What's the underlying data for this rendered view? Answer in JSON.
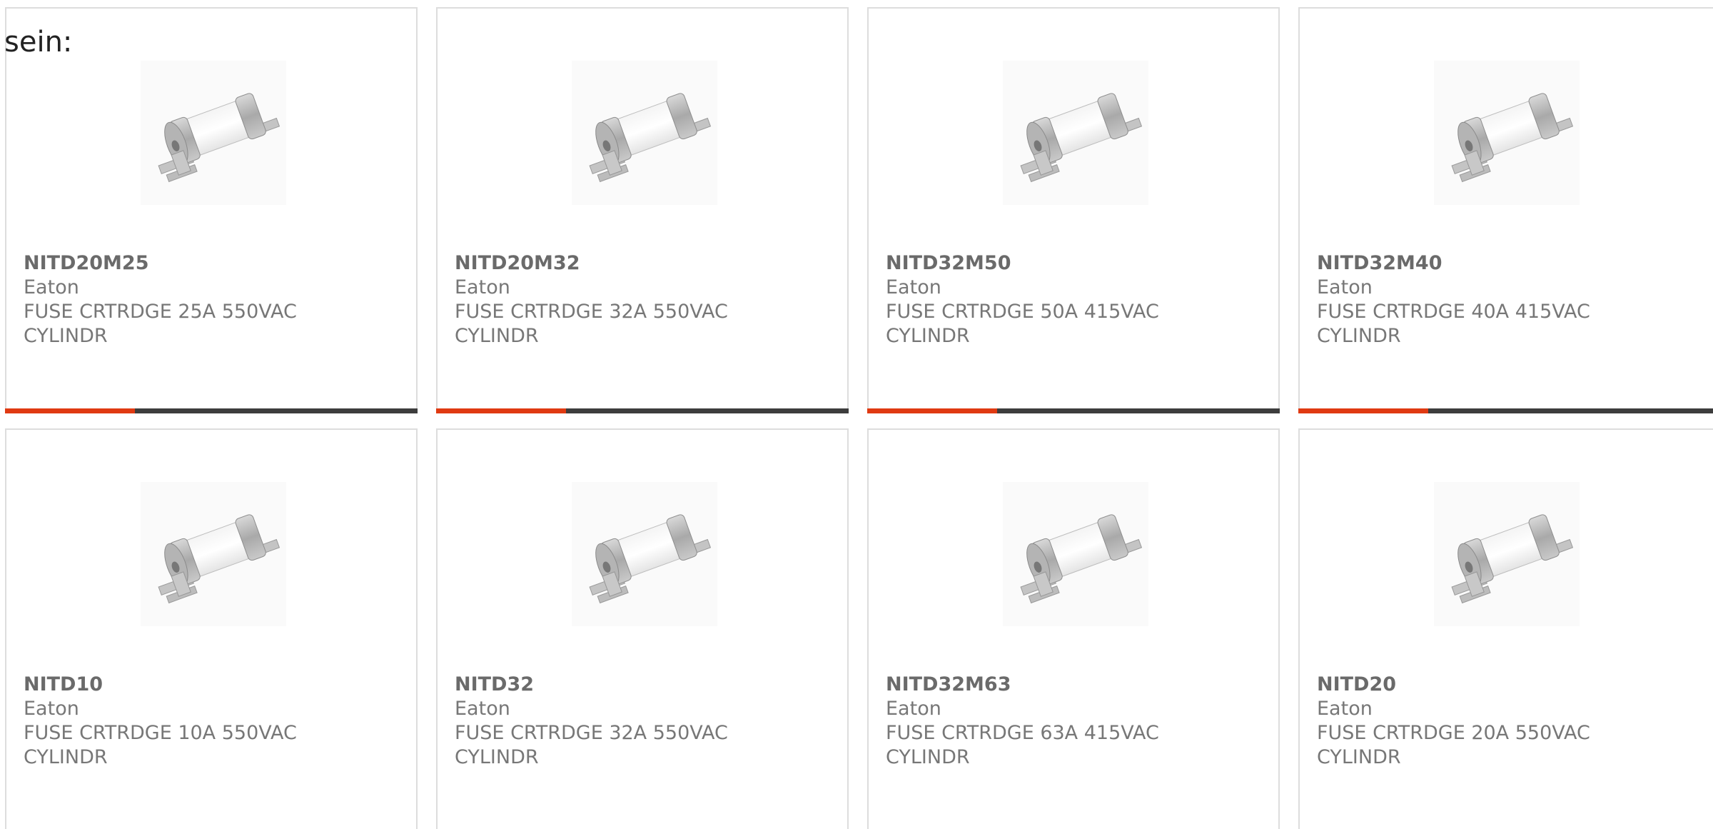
{
  "intro_text": "sein:",
  "colors": {
    "accent": "#e03a12",
    "bar_dark": "#3d3d3d",
    "border": "#dddddd",
    "text": "#777777"
  },
  "products": [
    {
      "part": "NITD20M25",
      "maker": "Eaton",
      "desc1": "FUSE CRTRDGE 25A 550VAC",
      "desc2": "CYLINDR",
      "image_icon": "fuse-cartridge-icon"
    },
    {
      "part": "NITD20M32",
      "maker": "Eaton",
      "desc1": "FUSE CRTRDGE 32A 550VAC",
      "desc2": "CYLINDR",
      "image_icon": "fuse-cartridge-icon"
    },
    {
      "part": "NITD32M50",
      "maker": "Eaton",
      "desc1": "FUSE CRTRDGE 50A 415VAC",
      "desc2": "CYLINDR",
      "image_icon": "fuse-cartridge-icon"
    },
    {
      "part": "NITD32M40",
      "maker": "Eaton",
      "desc1": "FUSE CRTRDGE 40A 415VAC",
      "desc2": "CYLINDR",
      "image_icon": "fuse-cartridge-icon"
    },
    {
      "part": "NITD10",
      "maker": "Eaton",
      "desc1": "FUSE CRTRDGE 10A 550VAC",
      "desc2": "CYLINDR",
      "image_icon": "fuse-cartridge-icon"
    },
    {
      "part": "NITD32",
      "maker": "Eaton",
      "desc1": "FUSE CRTRDGE 32A 550VAC",
      "desc2": "CYLINDR",
      "image_icon": "fuse-cartridge-icon"
    },
    {
      "part": "NITD32M63",
      "maker": "Eaton",
      "desc1": "FUSE CRTRDGE 63A 415VAC",
      "desc2": "CYLINDR",
      "image_icon": "fuse-cartridge-icon"
    },
    {
      "part": "NITD20",
      "maker": "Eaton",
      "desc1": "FUSE CRTRDGE 20A 550VAC",
      "desc2": "CYLINDR",
      "image_icon": "fuse-cartridge-icon"
    }
  ]
}
